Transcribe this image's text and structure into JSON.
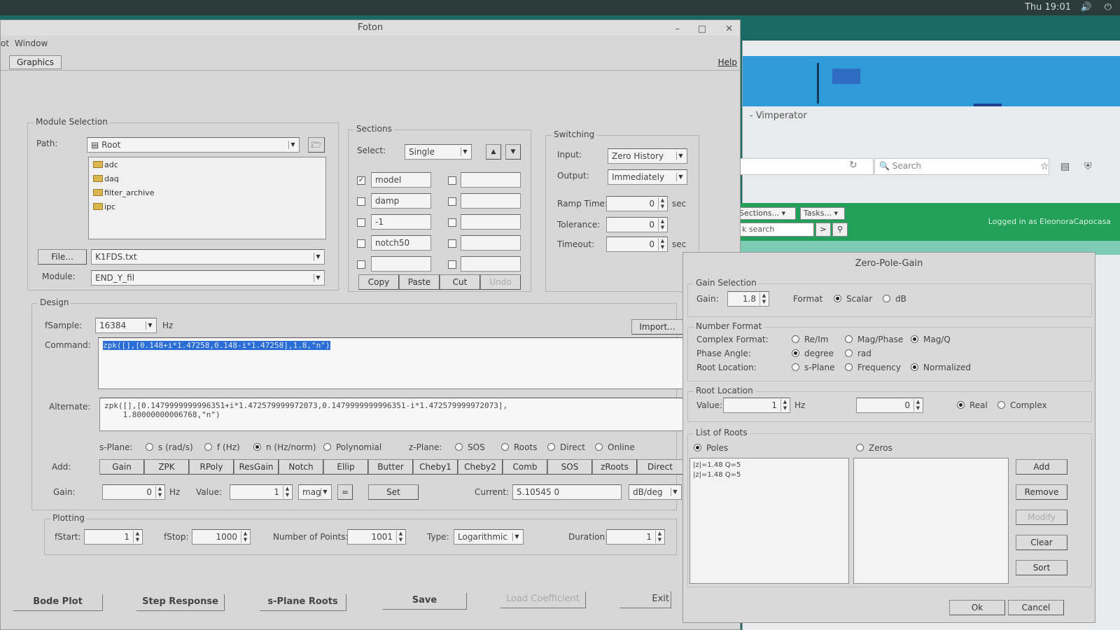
{
  "desktop": {
    "clock": "Thu 19:01",
    "volume_icon": "speaker-icon",
    "power_icon": "power-icon"
  },
  "browser": {
    "tab_title": "- Vimperator",
    "search_placeholder": "Search",
    "sections_select": "Sections...",
    "tasks_select": "Tasks...",
    "ksearch": "k search",
    "go_btn": ">",
    "logged_in": "Logged in as EleonoraCapocasa"
  },
  "foton": {
    "title": "Foton",
    "menu": {
      "plot": "ot",
      "window": "Window"
    },
    "tab": "Graphics",
    "help": "Help",
    "module_selection": {
      "legend": "Module Selection",
      "path_label": "Path:",
      "path_value": "Root",
      "tree": [
        "adc",
        "daq",
        "filter_archive",
        "ipc"
      ],
      "file_button": "File...",
      "file_value": "K1FDS.txt",
      "module_label": "Module:",
      "module_value": "END_Y_fil"
    },
    "sections": {
      "legend": "Sections",
      "select_label": "Select:",
      "select_value": "Single",
      "rows": [
        {
          "checked": true,
          "left": "model",
          "right": ""
        },
        {
          "checked": false,
          "left": "damp",
          "right": ""
        },
        {
          "checked": false,
          "left": "-1",
          "right": ""
        },
        {
          "checked": false,
          "left": "notch50",
          "right": ""
        },
        {
          "checked": false,
          "left": "",
          "right": ""
        }
      ],
      "buttons": [
        "Copy",
        "Paste",
        "Cut",
        "Undo"
      ]
    },
    "switching": {
      "legend": "Switching",
      "input_label": "Input:",
      "input_value": "Zero History",
      "output_label": "Output:",
      "output_value": "Immediately",
      "ramp_label": "Ramp Time:",
      "ramp_value": "0",
      "ramp_unit": "sec",
      "tolerance_label": "Tolerance:",
      "tolerance_value": "0",
      "timeout_label": "Timeout:",
      "timeout_value": "0",
      "timeout_unit": "sec"
    },
    "design": {
      "legend": "Design",
      "fsample_label": "fSample:",
      "fsample_value": "16384",
      "fsample_unit": "Hz",
      "import_button": "Import...",
      "command_label": "Command:",
      "command_value": "zpk([],[0.148+i*1.47258,0.148-i*1.47258],1.8,\"n\")",
      "alternate_label": "Alternate:",
      "alternate_value": "zpk([],[0.1479999999996351+i*1.472579999972073,0.1479999999996351-i*1.472579999972073],\n    1.80000000006768,\"n\")",
      "splane_label": "s-Plane:",
      "splane_options": [
        "s (rad/s)",
        "f (Hz)",
        "n (Hz/norm)",
        "Polynomial"
      ],
      "splane_selected": 2,
      "zplane_label": "z-Plane:",
      "zplane_options": [
        "SOS",
        "Roots",
        "Direct",
        "Online"
      ],
      "add_label": "Add:",
      "add_buttons": [
        "Gain",
        "ZPK",
        "RPoly",
        "ResGain",
        "Notch",
        "Ellip",
        "Butter",
        "Cheby1",
        "Cheby2",
        "Comb",
        "SOS",
        "zRoots",
        "Direct"
      ],
      "gain_label": "Gain:",
      "gain_value": "0",
      "gain_unit": "Hz",
      "value_label": "Value:",
      "value_value": "1",
      "mag_value": "mag",
      "eq_button": "=",
      "set_button": "Set",
      "current_label": "Current:",
      "current_value": "5.10545  0",
      "dbdeg_value": "dB/deg"
    },
    "plotting": {
      "legend": "Plotting",
      "fstart_label": "fStart:",
      "fstart_value": "1",
      "fstop_label": "fStop:",
      "fstop_value": "1000",
      "points_label": "Number of Points:",
      "points_value": "1001",
      "type_label": "Type:",
      "type_value": "Logarithmic",
      "duration_label": "Duration:",
      "duration_value": "1"
    },
    "bottom_buttons": [
      "Bode Plot",
      "Step Response",
      "s-Plane Roots",
      "Save",
      "Load Coefficient",
      "Exit"
    ]
  },
  "zpk": {
    "title": "Zero-Pole-Gain",
    "gain_selection": {
      "legend": "Gain Selection",
      "gain_label": "Gain:",
      "gain_value": "1.8",
      "format_label": "Format",
      "format_options": [
        "Scalar",
        "dB"
      ],
      "format_selected": 0
    },
    "number_format": {
      "legend": "Number Format",
      "complex_label": "Complex Format:",
      "complex_options": [
        "Re/Im",
        "Mag/Phase",
        "Mag/Q"
      ],
      "complex_selected": 2,
      "phase_label": "Phase Angle:",
      "phase_options": [
        "degree",
        "rad"
      ],
      "phase_selected": 0,
      "root_label": "Root Location:",
      "root_options": [
        "s-Plane",
        "Frequency",
        "Normalized"
      ],
      "root_selected": 2
    },
    "root_location": {
      "legend": "Root Location",
      "value_label": "Value:",
      "value1": "1",
      "unit": "Hz",
      "value2": "0",
      "options": [
        "Real",
        "Complex"
      ],
      "selected": 0
    },
    "list_of_roots": {
      "legend": "List of Roots",
      "poles_label": "Poles",
      "zeros_label": "Zeros",
      "selected": 0,
      "poles": [
        "|z|=1.48 Q=5",
        "|z|=1.48 Q=5"
      ],
      "zeros": []
    },
    "side_buttons": [
      "Add",
      "Remove",
      "Modify",
      "Clear",
      "Sort"
    ],
    "ok_button": "Ok",
    "cancel_button": "Cancel"
  }
}
